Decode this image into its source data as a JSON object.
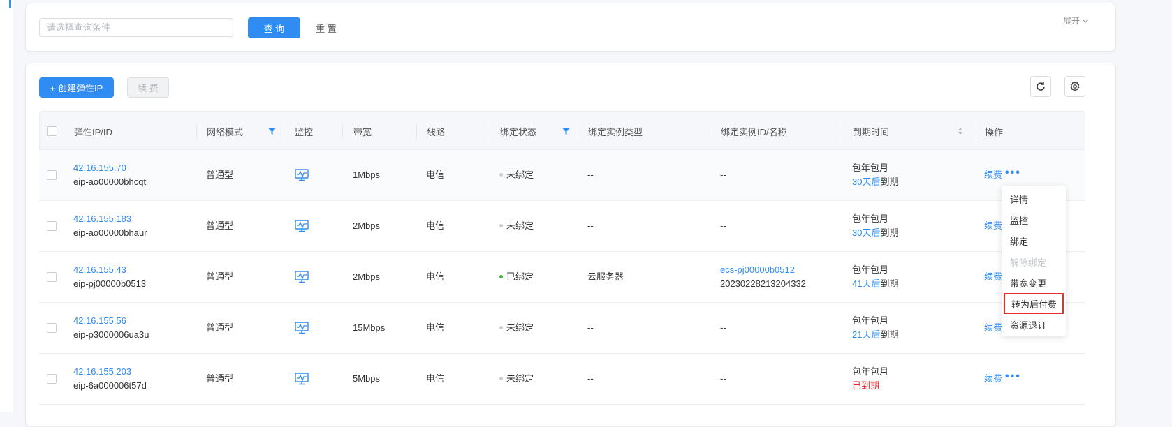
{
  "search": {
    "placeholder": "请选择查询条件",
    "query_label": "查 询",
    "reset_label": "重 置",
    "expand_label": "展开"
  },
  "toolbar": {
    "create_label": "+ 创建弹性IP",
    "renew_label": "续 费",
    "refresh_icon": "refresh-icon",
    "settings_icon": "gear-icon"
  },
  "table": {
    "columns": [
      "弹性IP/ID",
      "网络模式",
      "监控",
      "带宽",
      "线路",
      "绑定状态",
      "绑定实例类型",
      "绑定实例ID/名称",
      "到期时间",
      "操作"
    ],
    "rows": [
      {
        "ip": "42.16.155.70",
        "id": "eip-ao00000bhcqt",
        "mode": "普通型",
        "bandwidth": "1Mbps",
        "line": "电信",
        "status": "未绑定",
        "status_color": "#c8ccd2",
        "inst_type": "--",
        "inst_id": "--",
        "inst_name": "",
        "billing": "包年包月",
        "expiry_prefix": "30天后",
        "expiry_suffix": "到期",
        "renew": "续费"
      },
      {
        "ip": "42.16.155.183",
        "id": "eip-ao00000bhaur",
        "mode": "普通型",
        "bandwidth": "2Mbps",
        "line": "电信",
        "status": "未绑定",
        "status_color": "#c8ccd2",
        "inst_type": "--",
        "inst_id": "--",
        "inst_name": "",
        "billing": "包年包月",
        "expiry_prefix": "30天后",
        "expiry_suffix": "到期",
        "renew": "续费"
      },
      {
        "ip": "42.16.155.43",
        "id": "eip-pj00000b0513",
        "mode": "普通型",
        "bandwidth": "2Mbps",
        "line": "电信",
        "status": "已绑定",
        "status_color": "#3cb43c",
        "inst_type": "云服务器",
        "inst_id": "ecs-pj00000b0512",
        "inst_name": "20230228213204332",
        "billing": "包年包月",
        "expiry_prefix": "41天后",
        "expiry_suffix": "到期",
        "renew": "续费"
      },
      {
        "ip": "42.16.155.56",
        "id": "eip-p3000006ua3u",
        "mode": "普通型",
        "bandwidth": "15Mbps",
        "line": "电信",
        "status": "未绑定",
        "status_color": "#c8ccd2",
        "inst_type": "--",
        "inst_id": "--",
        "inst_name": "",
        "billing": "包年包月",
        "expiry_prefix": "21天后",
        "expiry_suffix": "到期",
        "renew": "续费"
      },
      {
        "ip": "42.16.155.203",
        "id": "eip-6a000006t57d",
        "mode": "普通型",
        "bandwidth": "5Mbps",
        "line": "电信",
        "status": "未绑定",
        "status_color": "#c8ccd2",
        "inst_type": "--",
        "inst_id": "--",
        "inst_name": "",
        "billing": "包年包月",
        "expiry_prefix": "已到期",
        "expiry_suffix": "",
        "renew": "续费"
      }
    ]
  },
  "dropdown": {
    "items": [
      "详情",
      "监控",
      "绑定",
      "解除绑定",
      "带宽变更",
      "转为后付费",
      "资源退订"
    ]
  },
  "colors": {
    "accent": "#2f8cf3",
    "expired": "#f5222d",
    "highlight_box": "#ee2c2c"
  }
}
